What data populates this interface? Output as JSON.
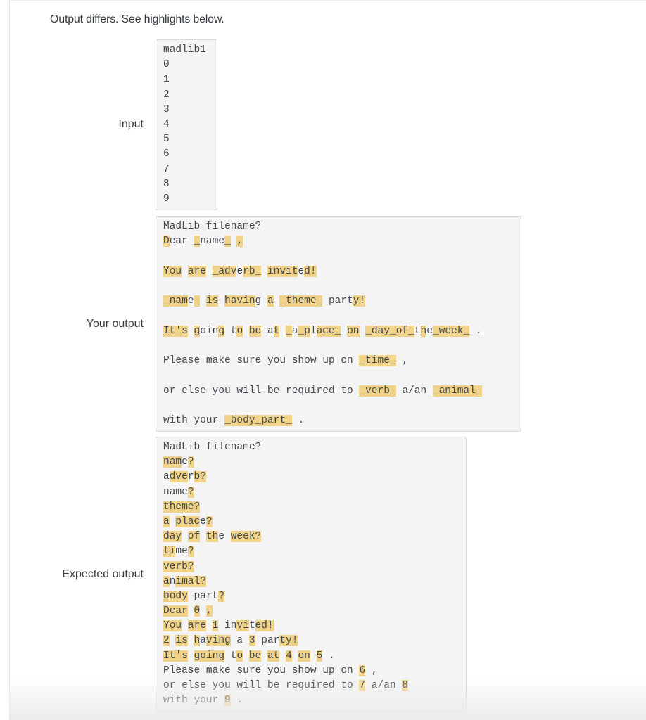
{
  "status_message": "Output differs. See highlights below.",
  "colors": {
    "highlight": "#f0d388",
    "box_background": "#f4f4f4",
    "box_border": "#d9d9d9"
  },
  "input": {
    "label": "Input",
    "lines": [
      "madlib1",
      "0",
      "1",
      "2",
      "3",
      "4",
      "5",
      "6",
      "7",
      "8",
      "9"
    ]
  },
  "your_output": {
    "label": "Your output",
    "lines": [
      [
        {
          "t": "MadLib filename?",
          "h": false
        }
      ],
      [
        {
          "t": "D",
          "h": true
        },
        {
          "t": "ear ",
          "h": false
        },
        {
          "t": "_",
          "h": true
        },
        {
          "t": "name",
          "h": false
        },
        {
          "t": "_",
          "h": true
        },
        {
          "t": " ",
          "h": false
        },
        {
          "t": ",",
          "h": true
        }
      ],
      [
        {
          "t": "You",
          "h": true
        },
        {
          "t": " ",
          "h": false
        },
        {
          "t": "are",
          "h": true
        },
        {
          "t": " ",
          "h": false
        },
        {
          "t": "_adv",
          "h": true
        },
        {
          "t": "e",
          "h": false
        },
        {
          "t": "rb_",
          "h": true
        },
        {
          "t": " ",
          "h": false
        },
        {
          "t": "invit",
          "h": true
        },
        {
          "t": "e",
          "h": false
        },
        {
          "t": "d!",
          "h": true
        }
      ],
      [
        {
          "t": "_nam",
          "h": true
        },
        {
          "t": "e",
          "h": false
        },
        {
          "t": "_",
          "h": true
        },
        {
          "t": " ",
          "h": false
        },
        {
          "t": "is",
          "h": true
        },
        {
          "t": " ",
          "h": false
        },
        {
          "t": "havin",
          "h": true
        },
        {
          "t": "g",
          "h": false
        },
        {
          "t": " ",
          "h": false
        },
        {
          "t": "a",
          "h": true
        },
        {
          "t": " ",
          "h": false
        },
        {
          "t": "_theme_",
          "h": true
        },
        {
          "t": " part",
          "h": false
        },
        {
          "t": "y!",
          "h": true
        }
      ],
      [
        {
          "t": "It's",
          "h": true
        },
        {
          "t": " ",
          "h": false
        },
        {
          "t": "g",
          "h": true
        },
        {
          "t": "oin",
          "h": false
        },
        {
          "t": "g",
          "h": true
        },
        {
          "t": " t",
          "h": false
        },
        {
          "t": "o",
          "h": true
        },
        {
          "t": " ",
          "h": false
        },
        {
          "t": "be",
          "h": true
        },
        {
          "t": " a",
          "h": false
        },
        {
          "t": "t",
          "h": true
        },
        {
          "t": " ",
          "h": false
        },
        {
          "t": "_",
          "h": true
        },
        {
          "t": "a",
          "h": false
        },
        {
          "t": "_p",
          "h": true
        },
        {
          "t": "l",
          "h": false
        },
        {
          "t": "ace_",
          "h": true
        },
        {
          "t": " ",
          "h": false
        },
        {
          "t": "on",
          "h": true
        },
        {
          "t": " ",
          "h": false
        },
        {
          "t": "_day_of_",
          "h": true
        },
        {
          "t": "t",
          "h": false
        },
        {
          "t": "h",
          "h": true
        },
        {
          "t": "e",
          "h": false
        },
        {
          "t": "_week_",
          "h": true
        },
        {
          "t": " .",
          "h": false
        }
      ],
      [
        {
          "t": "Please make sure you show up on ",
          "h": false
        },
        {
          "t": "_time_",
          "h": true
        },
        {
          "t": " ,",
          "h": false
        }
      ],
      [
        {
          "t": "or else you will be required to ",
          "h": false
        },
        {
          "t": "_verb_",
          "h": true
        },
        {
          "t": " a/an ",
          "h": false
        },
        {
          "t": "_animal_",
          "h": true
        }
      ],
      [
        {
          "t": "with your ",
          "h": false
        },
        {
          "t": "_body_part_",
          "h": true
        },
        {
          "t": " .",
          "h": false
        }
      ]
    ]
  },
  "expected_output": {
    "label": "Expected output",
    "lines": [
      [
        {
          "t": "MadLib filename?",
          "h": false
        }
      ],
      [
        {
          "t": "nam",
          "h": true
        },
        {
          "t": "e",
          "h": false
        },
        {
          "t": "?",
          "h": true
        }
      ],
      [
        {
          "t": "a",
          "h": false
        },
        {
          "t": "dve",
          "h": true
        },
        {
          "t": "r",
          "h": false
        },
        {
          "t": "b?",
          "h": true
        }
      ],
      [
        {
          "t": "name",
          "h": false
        },
        {
          "t": "?",
          "h": true
        }
      ],
      [
        {
          "t": "theme?",
          "h": true
        }
      ],
      [
        {
          "t": "a",
          "h": true
        },
        {
          "t": " ",
          "h": false
        },
        {
          "t": "plac",
          "h": true
        },
        {
          "t": "e",
          "h": false
        },
        {
          "t": "?",
          "h": true
        }
      ],
      [
        {
          "t": "day",
          "h": true
        },
        {
          "t": " ",
          "h": false
        },
        {
          "t": "of",
          "h": true
        },
        {
          "t": " ",
          "h": false
        },
        {
          "t": "th",
          "h": true
        },
        {
          "t": "e ",
          "h": false
        },
        {
          "t": "week?",
          "h": true
        }
      ],
      [
        {
          "t": "ti",
          "h": true
        },
        {
          "t": "me",
          "h": false
        },
        {
          "t": "?",
          "h": true
        }
      ],
      [
        {
          "t": "verb?",
          "h": true
        }
      ],
      [
        {
          "t": "a",
          "h": true
        },
        {
          "t": "n",
          "h": false
        },
        {
          "t": "imal?",
          "h": true
        }
      ],
      [
        {
          "t": "body",
          "h": true
        },
        {
          "t": " part",
          "h": false
        },
        {
          "t": "?",
          "h": true
        }
      ],
      [
        {
          "t": "Dear",
          "h": true
        },
        {
          "t": " ",
          "h": false
        },
        {
          "t": "0",
          "h": true
        },
        {
          "t": " ",
          "h": false
        },
        {
          "t": ",",
          "h": true
        }
      ],
      [
        {
          "t": "You",
          "h": true
        },
        {
          "t": " ",
          "h": false
        },
        {
          "t": "are",
          "h": true
        },
        {
          "t": " ",
          "h": false
        },
        {
          "t": "1",
          "h": true
        },
        {
          "t": " in",
          "h": false
        },
        {
          "t": "vi",
          "h": true
        },
        {
          "t": "t",
          "h": false
        },
        {
          "t": "ed!",
          "h": true
        }
      ],
      [
        {
          "t": "2",
          "h": true
        },
        {
          "t": " ",
          "h": false
        },
        {
          "t": "is",
          "h": true
        },
        {
          "t": " ",
          "h": false
        },
        {
          "t": "h",
          "h": true
        },
        {
          "t": "a",
          "h": false
        },
        {
          "t": "ving",
          "h": true
        },
        {
          "t": " a ",
          "h": false
        },
        {
          "t": "3",
          "h": true
        },
        {
          "t": " par",
          "h": false
        },
        {
          "t": "ty!",
          "h": true
        }
      ],
      [
        {
          "t": "It's",
          "h": true
        },
        {
          "t": " ",
          "h": false
        },
        {
          "t": "going",
          "h": true
        },
        {
          "t": " t",
          "h": false
        },
        {
          "t": "o",
          "h": true
        },
        {
          "t": " ",
          "h": false
        },
        {
          "t": "be",
          "h": true
        },
        {
          "t": " ",
          "h": false
        },
        {
          "t": "at",
          "h": true
        },
        {
          "t": " ",
          "h": false
        },
        {
          "t": "4",
          "h": true
        },
        {
          "t": " ",
          "h": false
        },
        {
          "t": "on",
          "h": true
        },
        {
          "t": " ",
          "h": false
        },
        {
          "t": "5",
          "h": true
        },
        {
          "t": " .",
          "h": false
        }
      ],
      [
        {
          "t": "Please make sure you show up on ",
          "h": false
        },
        {
          "t": "6",
          "h": true
        },
        {
          "t": " ,",
          "h": false
        }
      ],
      [
        {
          "t": "or else you will be required to ",
          "h": false
        },
        {
          "t": "7",
          "h": true
        },
        {
          "t": " a/an ",
          "h": false
        },
        {
          "t": "8",
          "h": true
        }
      ],
      [
        {
          "t": "with your ",
          "h": false
        },
        {
          "t": "9",
          "h": true
        },
        {
          "t": " .",
          "h": false
        }
      ]
    ]
  }
}
